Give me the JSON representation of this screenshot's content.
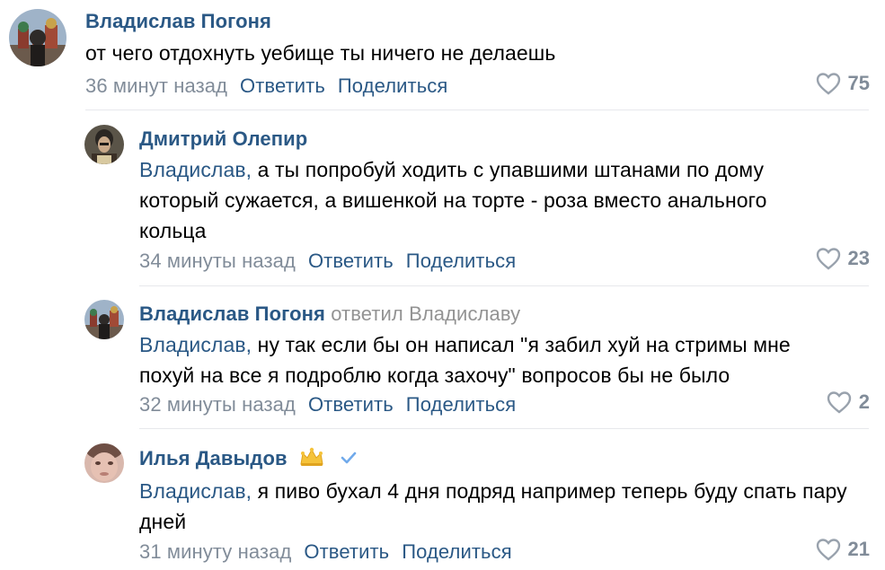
{
  "colors": {
    "accent": "#2a5885",
    "muted": "#818c99",
    "divider": "#e7e8ec"
  },
  "comments": [
    {
      "author": "Владислав Погоня",
      "text": "от чего отдохнуть уебище ты ничего не делаешь",
      "time": "36 минут назад",
      "reply_label": "Ответить",
      "share_label": "Поделиться",
      "likes": "75"
    },
    {
      "author": "Дмитрий Олепир",
      "mention": "Владислав,",
      "text": " а ты попробуй ходить с упавшими штанами по дому который сужается, а вишенкой на торте - роза вместо анального кольца",
      "time": "34 минуты назад",
      "reply_label": "Ответить",
      "share_label": "Поделиться",
      "likes": "23"
    },
    {
      "author": "Владислав Погоня",
      "replied_to": "ответил Владиславу",
      "mention": "Владислав,",
      "text": " ну так если бы он написал \"я забил хуй на стримы мне похуй на все я подроблю когда захочу\" вопросов бы не было",
      "time": "32 минуты назад",
      "reply_label": "Ответить",
      "share_label": "Поделиться",
      "likes": "2"
    },
    {
      "author": "Илья Давыдов",
      "badges": [
        "crown-icon",
        "verified-check-icon"
      ],
      "mention": "Владислав,",
      "text": " я пиво бухал 4 дня подряд например теперь буду спать пару дней",
      "time": "31 минуту назад",
      "reply_label": "Ответить",
      "share_label": "Поделиться",
      "likes": "21"
    }
  ]
}
